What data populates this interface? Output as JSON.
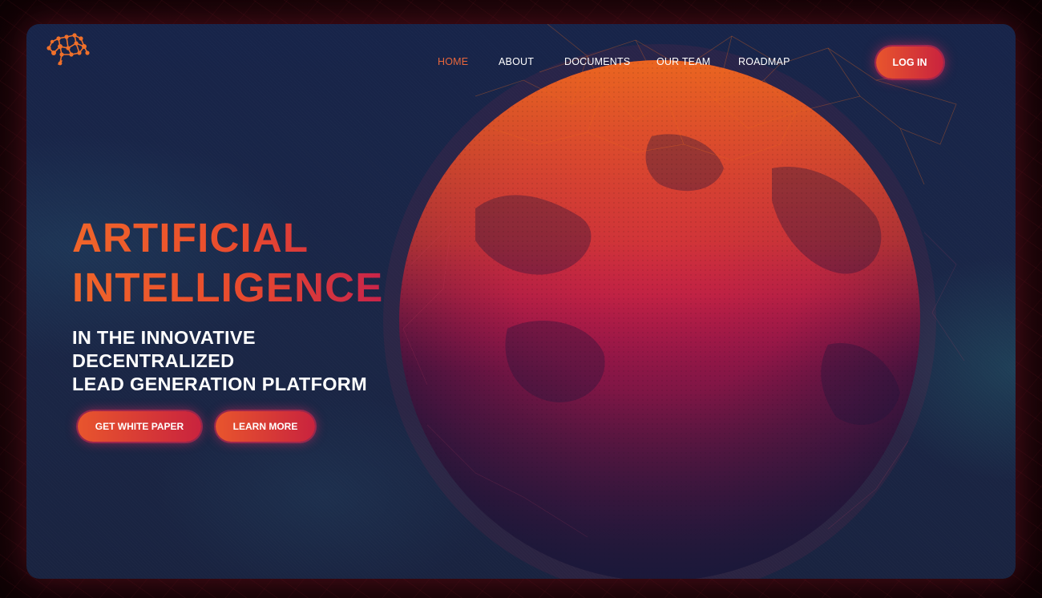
{
  "brand": {
    "logo_icon": "brain-network-icon",
    "accent": "#e8663b",
    "accent_end": "#c9233e",
    "background": "#172449"
  },
  "nav": {
    "items": [
      {
        "label": "HOME",
        "active": true
      },
      {
        "label": "ABOUT",
        "active": false
      },
      {
        "label": "DOCUMENTS",
        "active": false
      },
      {
        "label": "OUR TEAM",
        "active": false
      },
      {
        "label": "ROADMAP",
        "active": false
      }
    ],
    "login_label": "LOG IN"
  },
  "hero": {
    "title_line1": "ARTIFICIAL",
    "title_line2": "INTELLIGENCE",
    "subtitle_line1": "IN THE INNOVATIVE",
    "subtitle_line2": "DECENTRALIZED",
    "subtitle_line3": "LEAD GENERATION PLATFORM",
    "cta_primary": "GET WHITE PAPER",
    "cta_secondary": "LEARN MORE"
  }
}
